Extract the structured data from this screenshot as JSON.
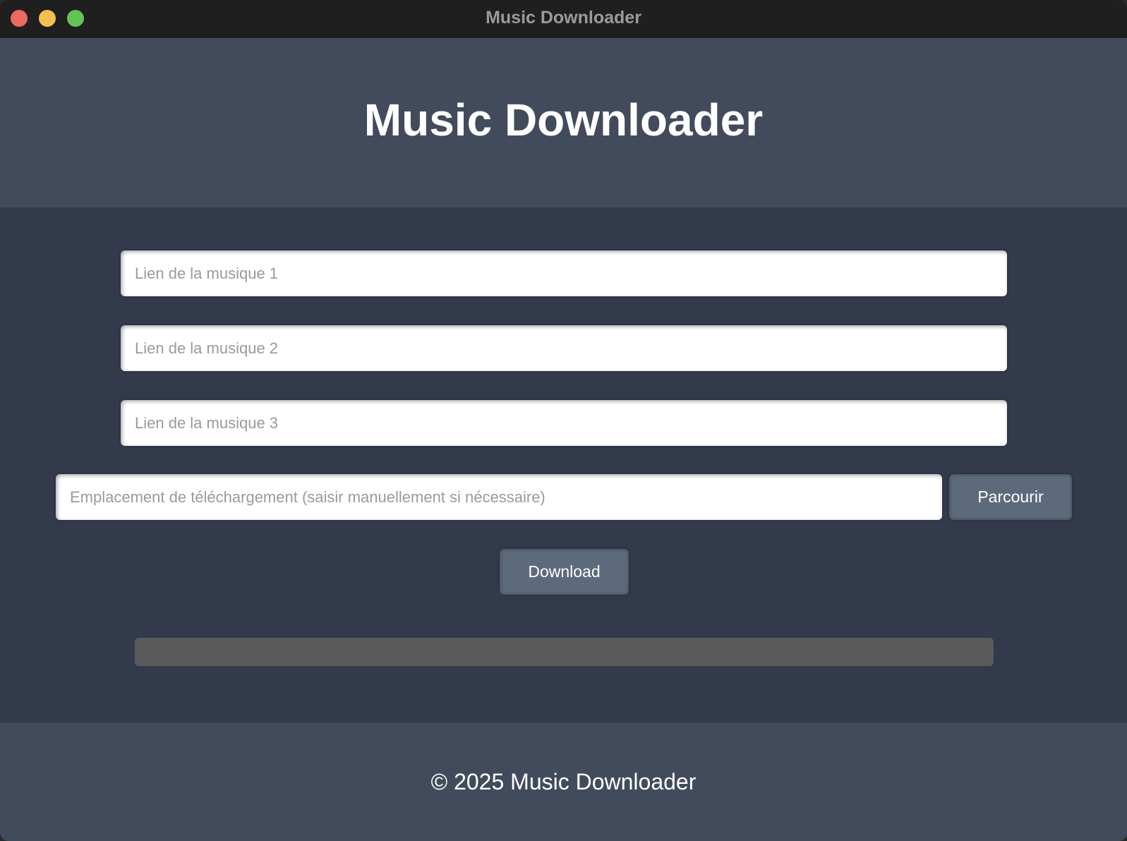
{
  "window": {
    "title": "Music Downloader"
  },
  "header": {
    "title": "Music Downloader"
  },
  "form": {
    "links": [
      {
        "value": "",
        "placeholder": "Lien de la musique 1"
      },
      {
        "value": "",
        "placeholder": "Lien de la musique 2"
      },
      {
        "value": "",
        "placeholder": "Lien de la musique 3"
      }
    ],
    "download_path": {
      "value": "",
      "placeholder": "Emplacement de téléchargement (saisir manuellement si nécessaire)"
    },
    "browse_label": "Parcourir",
    "download_label": "Download"
  },
  "progress": {
    "fraction": 0
  },
  "footer": {
    "text": "© 2025 Music Downloader"
  },
  "colors": {
    "titlebar": "#1f1f1f",
    "header_bg": "#424b5b",
    "main_bg": "#323a4c",
    "button_bg": "#5d6a7c",
    "progress_track": "#5a5a5a",
    "close": "#ed6a5e",
    "minimize": "#f5bf4f",
    "zoom": "#61c554"
  }
}
